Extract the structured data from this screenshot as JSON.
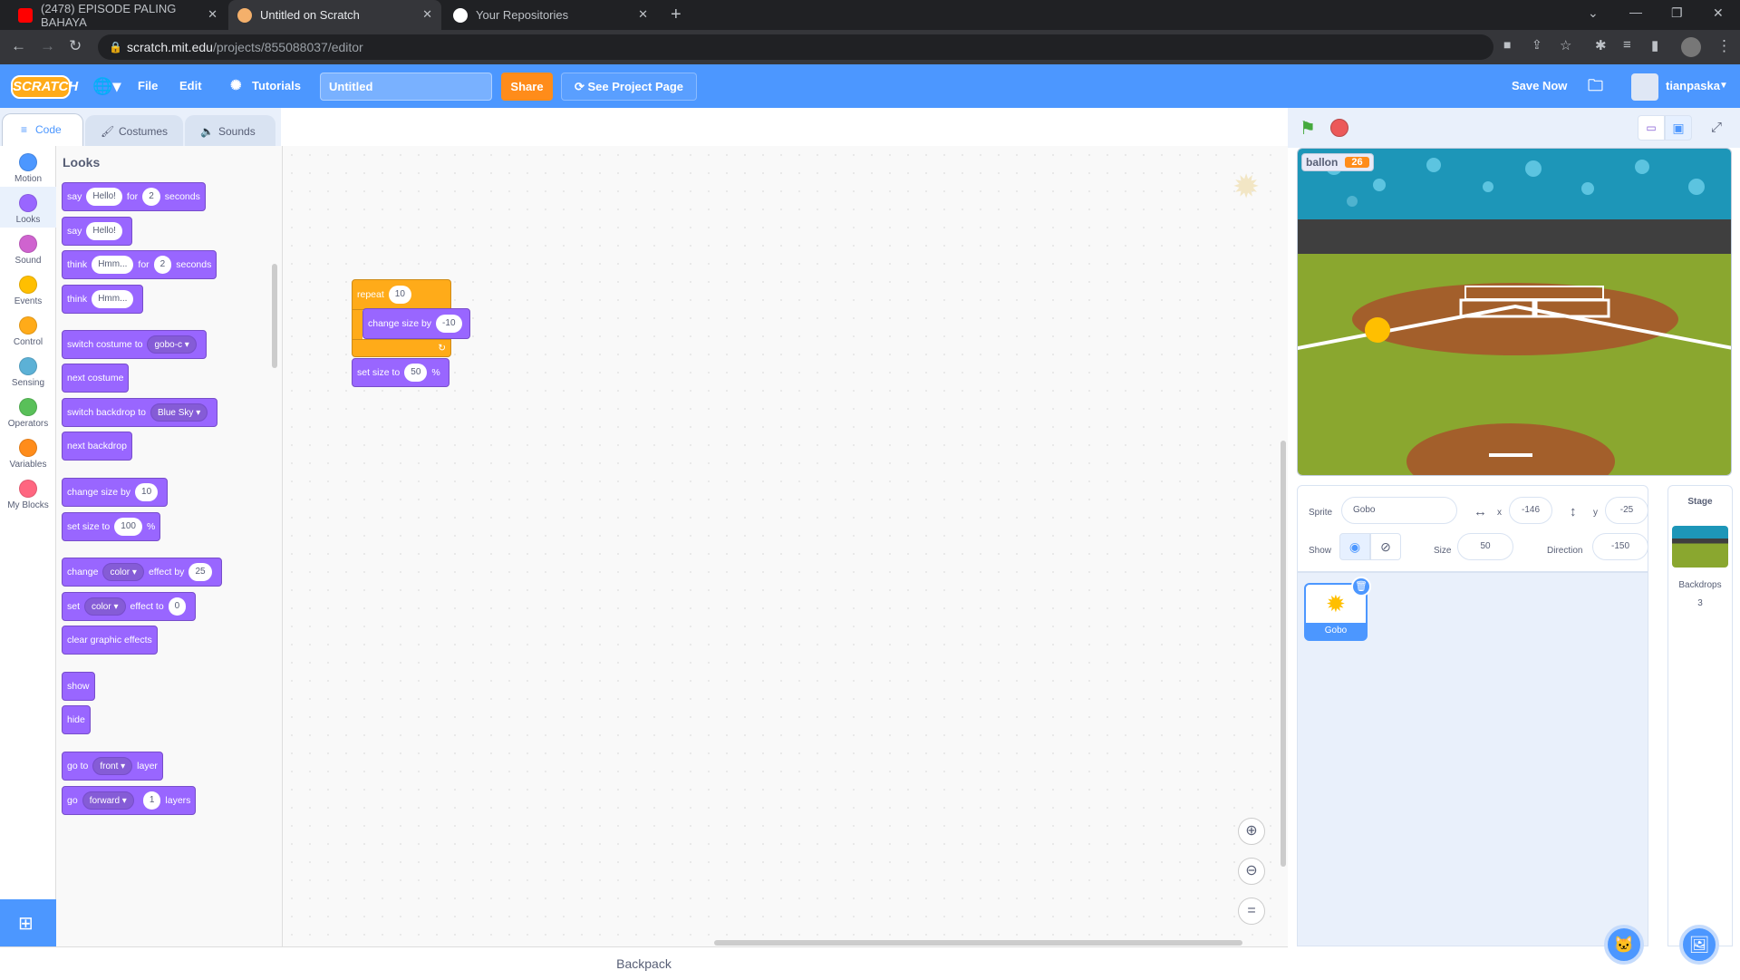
{
  "browser": {
    "tabs": [
      {
        "title": "(2478) EPISODE PALING BAHAYA",
        "favicon_color": "#ff0000"
      },
      {
        "title": "Untitled on Scratch",
        "favicon_color": "#f4b06b"
      },
      {
        "title": "Your Repositories",
        "favicon_color": "#ffffff"
      }
    ],
    "url_host": "scratch.mit.edu",
    "url_path": "/projects/855088037/editor"
  },
  "menu": {
    "logo": "SCRATCH",
    "file": "File",
    "edit": "Edit",
    "tutorials": "Tutorials",
    "project_title": "Untitled",
    "share": "Share",
    "see_project_page": "See Project Page",
    "save_now": "Save Now",
    "username": "tianpaska"
  },
  "editor_tabs": {
    "code": "Code",
    "costumes": "Costumes",
    "sounds": "Sounds"
  },
  "categories": [
    {
      "label": "Motion",
      "color": "#4c97ff"
    },
    {
      "label": "Looks",
      "color": "#9966ff"
    },
    {
      "label": "Sound",
      "color": "#cf63cf"
    },
    {
      "label": "Events",
      "color": "#ffbf00"
    },
    {
      "label": "Control",
      "color": "#ffab19"
    },
    {
      "label": "Sensing",
      "color": "#5cb1d6"
    },
    {
      "label": "Operators",
      "color": "#59c059"
    },
    {
      "label": "Variables",
      "color": "#ff8c1a"
    },
    {
      "label": "My Blocks",
      "color": "#ff6680"
    }
  ],
  "palette": {
    "title": "Looks",
    "blocks": [
      {
        "parts": [
          "say",
          "Hello!",
          "for",
          "2",
          "seconds"
        ]
      },
      {
        "parts": [
          "say",
          "Hello!"
        ]
      },
      {
        "parts": [
          "think",
          "Hmm...",
          "for",
          "2",
          "seconds"
        ]
      },
      {
        "parts": [
          "think",
          "Hmm..."
        ]
      },
      {
        "parts": [
          "switch costume to",
          "gobo-c"
        ]
      },
      {
        "parts": [
          "next costume"
        ]
      },
      {
        "parts": [
          "switch backdrop to",
          "Blue Sky"
        ]
      },
      {
        "parts": [
          "next backdrop"
        ]
      },
      {
        "parts": [
          "change size by",
          "10"
        ]
      },
      {
        "parts": [
          "set size to",
          "100",
          "%"
        ]
      },
      {
        "parts": [
          "change",
          "color",
          "effect by",
          "25"
        ]
      },
      {
        "parts": [
          "set",
          "color",
          "effect to",
          "0"
        ]
      },
      {
        "parts": [
          "clear graphic effects"
        ]
      },
      {
        "parts": [
          "show"
        ]
      },
      {
        "parts": [
          "hide"
        ]
      },
      {
        "parts": [
          "go to",
          "front",
          "layer"
        ]
      },
      {
        "parts": [
          "go",
          "forward",
          "1",
          "layers"
        ]
      }
    ]
  },
  "script": {
    "repeat_label": "repeat",
    "repeat_count": "10",
    "change_label": "change size by",
    "change_value": "-10",
    "set_label": "set size to",
    "set_value": "50",
    "set_unit": "%"
  },
  "backpack": "Backpack",
  "stage": {
    "monitor_name": "ballon",
    "monitor_value": "26"
  },
  "sprite_info": {
    "sprite_label": "Sprite",
    "sprite_name": "Gobo",
    "x_label": "x",
    "x_value": "-146",
    "y_label": "y",
    "y_value": "-25",
    "show_label": "Show",
    "size_label": "Size",
    "size_value": "50",
    "direction_label": "Direction",
    "direction_value": "-150"
  },
  "sprites": [
    {
      "name": "Gobo"
    }
  ],
  "stage_pane": {
    "title": "Stage",
    "backdrops_label": "Backdrops",
    "backdrops_count": "3"
  }
}
